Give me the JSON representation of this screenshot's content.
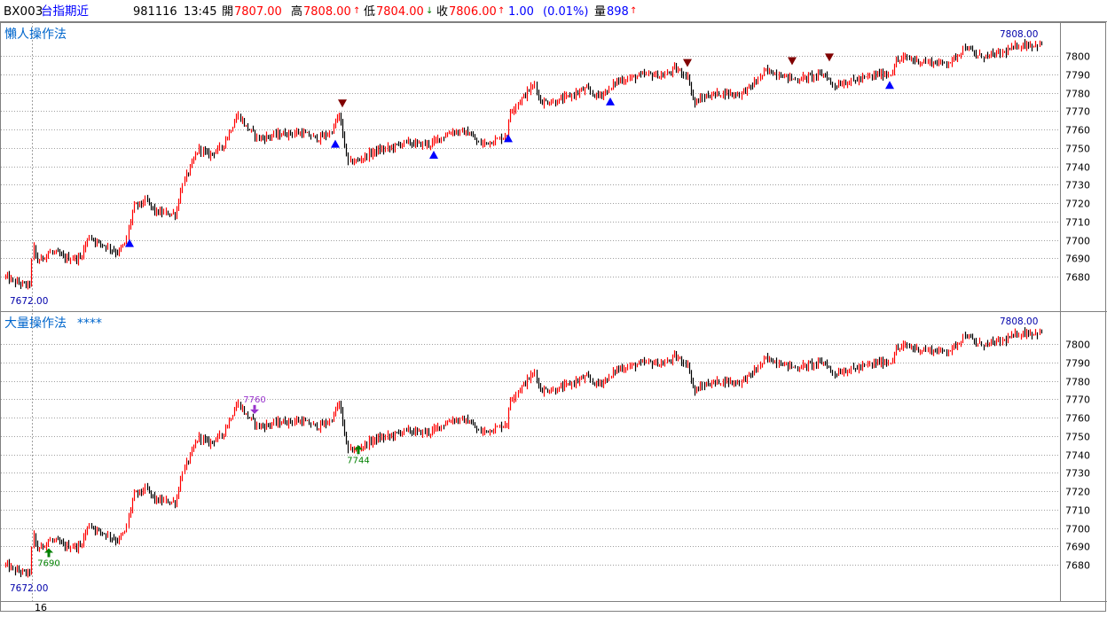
{
  "header": {
    "symbol": "BX003",
    "name": "台指期近",
    "date": "981116",
    "time": "13:45",
    "open_label": "開",
    "open_value": "7807.00",
    "high_label": "高",
    "high_value": "7808.00",
    "high_arrow": "↑",
    "low_label": "低",
    "low_value": "7804.00",
    "low_arrow": "↓",
    "close_label": "收",
    "close_value": "7806.00",
    "close_arrow": "↑",
    "change": "1.00",
    "change_pct": "(0.01%)",
    "volume_label": "量",
    "volume_value": "898",
    "volume_arrow": "↑"
  },
  "colors": {
    "up_bar": "#ff0000",
    "down_bar": "#000000",
    "buy_signal": "#0000ff",
    "sell_signal": "#800000",
    "green_marker": "#008000",
    "purple_marker": "#9933cc",
    "title_text": "#0066cc",
    "grid": "#a0a0a0"
  },
  "chart_data": [
    {
      "type": "bar",
      "title": "懶人操作法",
      "ylim": [
        7670,
        7814
      ],
      "y_ticks": [
        7680,
        7690,
        7700,
        7710,
        7720,
        7730,
        7740,
        7750,
        7760,
        7770,
        7780,
        7790,
        7800
      ],
      "grid": true,
      "high_label": "7808.00",
      "low_label": "7672.00",
      "up_signals": [
        {
          "x": 146,
          "y": 7698
        },
        {
          "x": 378,
          "y": 7752
        },
        {
          "x": 489,
          "y": 7746
        },
        {
          "x": 573,
          "y": 7755
        },
        {
          "x": 688,
          "y": 7775
        },
        {
          "x": 1003,
          "y": 7784
        }
      ],
      "down_signals": [
        {
          "x": 386,
          "y": 7770
        },
        {
          "x": 775,
          "y": 7792
        },
        {
          "x": 893,
          "y": 7793
        },
        {
          "x": 935,
          "y": 7795
        }
      ],
      "anchors": [
        [
          6,
          7680
        ],
        [
          16,
          7677
        ],
        [
          33,
          7675
        ],
        [
          37,
          7697
        ],
        [
          41,
          7688
        ],
        [
          55,
          7693
        ],
        [
          62,
          7693
        ],
        [
          72,
          7690
        ],
        [
          90,
          7690
        ],
        [
          100,
          7702
        ],
        [
          108,
          7699
        ],
        [
          118,
          7697
        ],
        [
          132,
          7693
        ],
        [
          141,
          7698
        ],
        [
          150,
          7718
        ],
        [
          165,
          7721
        ],
        [
          175,
          7715
        ],
        [
          198,
          7714
        ],
        [
          205,
          7730
        ],
        [
          215,
          7740
        ],
        [
          224,
          7750
        ],
        [
          234,
          7746
        ],
        [
          249,
          7750
        ],
        [
          263,
          7763
        ],
        [
          268,
          7768
        ],
        [
          276,
          7762
        ],
        [
          292,
          7755
        ],
        [
          310,
          7757
        ],
        [
          325,
          7758
        ],
        [
          340,
          7758
        ],
        [
          358,
          7755
        ],
        [
          372,
          7758
        ],
        [
          382,
          7768
        ],
        [
          388,
          7752
        ],
        [
          392,
          7742
        ],
        [
          403,
          7743
        ],
        [
          421,
          7748
        ],
        [
          440,
          7750
        ],
        [
          456,
          7753
        ],
        [
          470,
          7752
        ],
        [
          485,
          7752
        ],
        [
          494,
          7755
        ],
        [
          510,
          7759
        ],
        [
          528,
          7758
        ],
        [
          540,
          7752
        ],
        [
          558,
          7754
        ],
        [
          571,
          7757
        ],
        [
          575,
          7770
        ],
        [
          590,
          7778
        ],
        [
          603,
          7785
        ],
        [
          608,
          7775
        ],
        [
          626,
          7775
        ],
        [
          641,
          7778
        ],
        [
          660,
          7782
        ],
        [
          672,
          7778
        ],
        [
          688,
          7782
        ],
        [
          693,
          7786
        ],
        [
          711,
          7788
        ],
        [
          730,
          7790
        ],
        [
          748,
          7789
        ],
        [
          760,
          7793
        ],
        [
          772,
          7790
        ],
        [
          776,
          7787
        ],
        [
          782,
          7774
        ],
        [
          795,
          7778
        ],
        [
          815,
          7780
        ],
        [
          832,
          7779
        ],
        [
          848,
          7784
        ],
        [
          863,
          7792
        ],
        [
          878,
          7790
        ],
        [
          897,
          7787
        ],
        [
          915,
          7789
        ],
        [
          930,
          7790
        ],
        [
          938,
          7784
        ],
        [
          958,
          7786
        ],
        [
          975,
          7788
        ],
        [
          991,
          7790
        ],
        [
          1003,
          7790
        ],
        [
          1010,
          7797
        ],
        [
          1020,
          7799
        ],
        [
          1037,
          7797
        ],
        [
          1060,
          7796
        ],
        [
          1072,
          7797
        ],
        [
          1088,
          7805
        ],
        [
          1100,
          7800
        ],
        [
          1115,
          7800
        ],
        [
          1132,
          7802
        ],
        [
          1150,
          7806
        ],
        [
          1165,
          7806
        ],
        [
          1175,
          7806
        ]
      ]
    },
    {
      "type": "bar",
      "title": "大量操作法",
      "title_suffix": "****",
      "ylim": [
        7670,
        7814
      ],
      "y_ticks": [
        7680,
        7690,
        7700,
        7710,
        7720,
        7730,
        7740,
        7750,
        7760,
        7770,
        7780,
        7790,
        7800
      ],
      "grid": true,
      "high_label": "7808.00",
      "low_label": "7672.00",
      "markers": [
        {
          "x": 55,
          "y": 7687,
          "label": "7690",
          "direction": "up"
        },
        {
          "x": 287,
          "y": 7762,
          "label": "7760",
          "direction": "down"
        },
        {
          "x": 404,
          "y": 7743,
          "label": "7744",
          "direction": "up"
        }
      ]
    }
  ],
  "time_axis": {
    "label": "16"
  }
}
